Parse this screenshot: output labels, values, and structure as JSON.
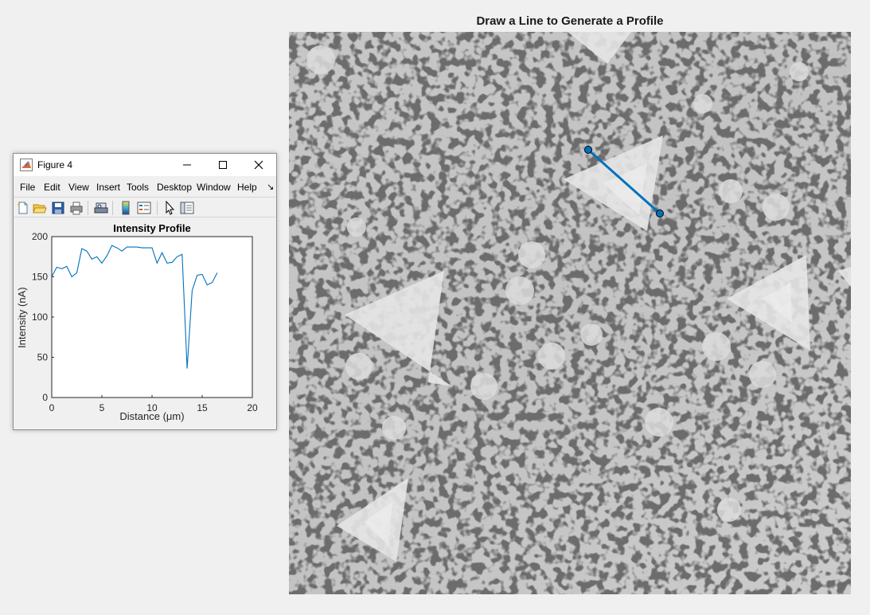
{
  "main_figure": {
    "title": "Draw a Line to Generate a Profile",
    "line_color": "#0072bd"
  },
  "profile_window": {
    "title": "Figure 4",
    "menu": [
      "File",
      "Edit",
      "View",
      "Insert",
      "Tools",
      "Desktop",
      "Window",
      "Help"
    ],
    "menu_overflow": "↘",
    "toolbar_icons": [
      "new-file-icon",
      "open-folder-icon",
      "save-icon",
      "print-icon",
      "print-preview-icon",
      "colorbar-icon",
      "legend-icon",
      "pointer-icon",
      "property-inspector-icon"
    ],
    "window_buttons": [
      "minimize-icon",
      "maximize-icon",
      "close-icon"
    ]
  },
  "chart_data": {
    "type": "line",
    "title": "Intensity Profile",
    "xlabel": "Distance (μm)",
    "ylabel": "Intensity (nA)",
    "xlim": [
      0,
      20
    ],
    "ylim": [
      0,
      200
    ],
    "xticks": [
      0,
      5,
      10,
      15,
      20
    ],
    "yticks": [
      0,
      50,
      100,
      150,
      200
    ],
    "grid": false,
    "color": "#0072bd",
    "series": [
      {
        "x": [
          0,
          0.5,
          1.0,
          1.5,
          2.0,
          2.5,
          3.0,
          3.5,
          4.0,
          4.5,
          5.0,
          5.5,
          6.0,
          6.5,
          7.0,
          7.5,
          8.0,
          8.5,
          9.0,
          9.5,
          10.0,
          10.5,
          11.0,
          11.5,
          12.0,
          12.5,
          13.0,
          13.5,
          14.0,
          14.5,
          15.0,
          15.5,
          16.0,
          16.5
        ],
        "y": [
          150,
          162,
          160,
          163,
          150,
          155,
          185,
          182,
          172,
          175,
          167,
          176,
          189,
          186,
          182,
          187,
          187,
          187,
          186,
          186,
          186,
          167,
          180,
          167,
          168,
          175,
          178,
          36,
          133,
          152,
          153,
          140,
          143,
          155
        ]
      }
    ]
  }
}
